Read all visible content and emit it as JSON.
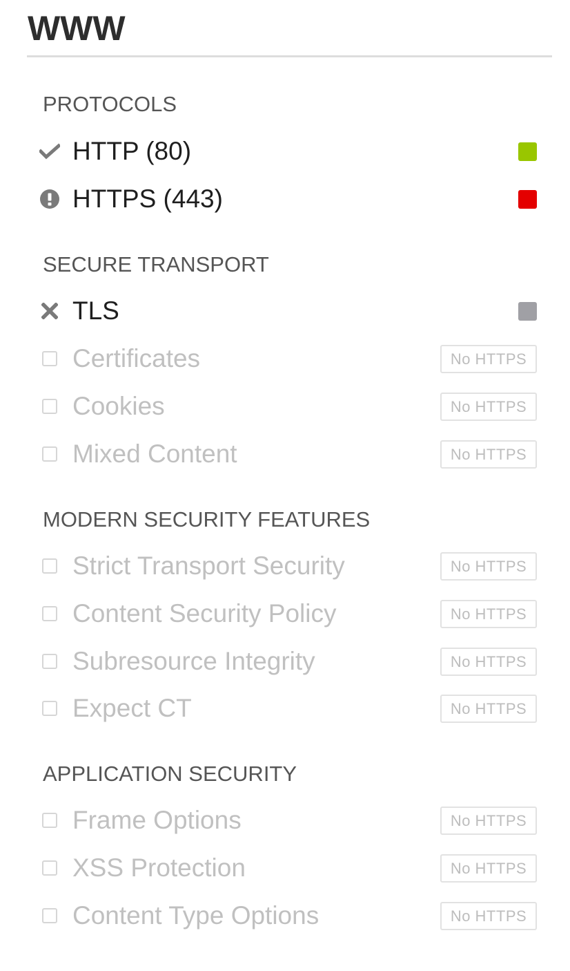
{
  "page": {
    "title": "WWW"
  },
  "colors": {
    "pass": "#99c600",
    "fail": "#e40000",
    "neutral": "#a0a0a5"
  },
  "sections": [
    {
      "heading": "PROTOCOLS",
      "rows": [
        {
          "label": "HTTP (80)",
          "icon": "check-icon",
          "state": "pass"
        },
        {
          "label": "HTTPS (443)",
          "icon": "alert-icon",
          "state": "fail"
        }
      ]
    },
    {
      "heading": "SECURE TRANSPORT",
      "rows": [
        {
          "label": "TLS",
          "icon": "x-icon",
          "state": "neutral"
        },
        {
          "label": "Certificates",
          "icon": "checkbox-icon",
          "badge": "No HTTPS"
        },
        {
          "label": "Cookies",
          "icon": "checkbox-icon",
          "badge": "No HTTPS"
        },
        {
          "label": "Mixed Content",
          "icon": "checkbox-icon",
          "badge": "No HTTPS"
        }
      ]
    },
    {
      "heading": "MODERN SECURITY FEATURES",
      "rows": [
        {
          "label": "Strict Transport Security",
          "icon": "checkbox-icon",
          "badge": "No HTTPS"
        },
        {
          "label": "Content Security Policy",
          "icon": "checkbox-icon",
          "badge": "No HTTPS"
        },
        {
          "label": "Subresource Integrity",
          "icon": "checkbox-icon",
          "badge": "No HTTPS"
        },
        {
          "label": "Expect CT",
          "icon": "checkbox-icon",
          "badge": "No HTTPS"
        }
      ]
    },
    {
      "heading": "APPLICATION SECURITY",
      "rows": [
        {
          "label": "Frame Options",
          "icon": "checkbox-icon",
          "badge": "No HTTPS"
        },
        {
          "label": "XSS Protection",
          "icon": "checkbox-icon",
          "badge": "No HTTPS"
        },
        {
          "label": "Content Type Options",
          "icon": "checkbox-icon",
          "badge": "No HTTPS"
        }
      ]
    }
  ]
}
